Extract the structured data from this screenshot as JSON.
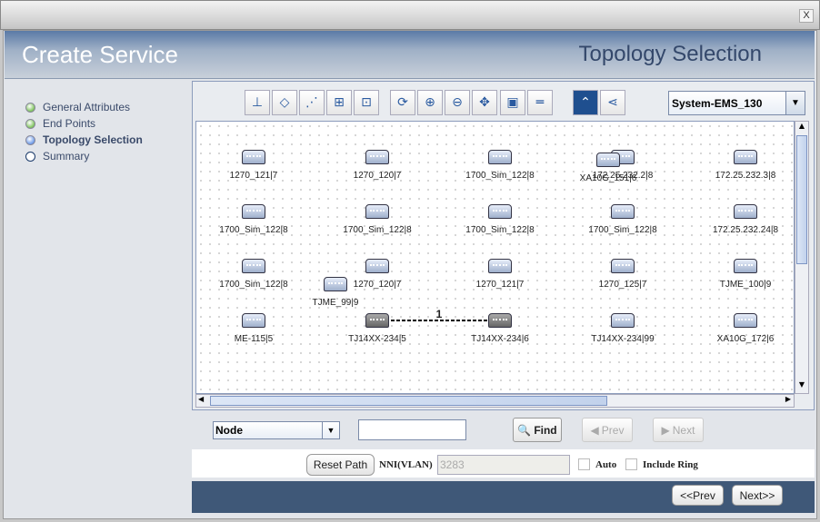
{
  "window": {
    "close_label": "X"
  },
  "header": {
    "title": "Create Service",
    "step_title": "Topology Selection"
  },
  "steps": [
    {
      "label": "General Attributes",
      "state": "done",
      "color": "#7cc25a"
    },
    {
      "label": "End Points",
      "state": "done",
      "color": "#7cc25a"
    },
    {
      "label": "Topology Selection",
      "state": "current",
      "color": "#6c9ae8"
    },
    {
      "label": "Summary",
      "state": "pending",
      "color": "#ffffff"
    }
  ],
  "toolbar": {
    "buttons": [
      "tree-layout-icon",
      "circular-layout-icon",
      "diagonal-layout-icon",
      "hierarchical-layout-icon",
      "grid-layout-icon",
      "refresh-icon",
      "zoom-in-icon",
      "zoom-out-icon",
      "pan-icon",
      "fit-icon",
      "line-icon",
      "collapse-icon",
      "share-icon"
    ],
    "ems_select": "System-EMS_130"
  },
  "topology": {
    "nodes": [
      {
        "label": "1270_121|7"
      },
      {
        "label": "1270_120|7"
      },
      {
        "label": "1700_Sim_122|8"
      },
      {
        "label": "172.25.232.2|8"
      },
      {
        "label": "172.25.232.3|8"
      },
      {
        "label": "1700_Sim_122|8"
      },
      {
        "label": "1700_Sim_122|8"
      },
      {
        "label": "1700_Sim_122|8"
      },
      {
        "label": "1700_Sim_122|8"
      },
      {
        "label": "172.25.232.24|8"
      },
      {
        "label": "1700_Sim_122|8"
      },
      {
        "label": "1270_120|7"
      },
      {
        "label": "1270_121|7"
      },
      {
        "label": "1270_125|7"
      },
      {
        "label": "TJME_100|9"
      },
      {
        "label": "ME-115|5"
      },
      {
        "label": "TJ14XX-234|5",
        "selected": true
      },
      {
        "label": "TJ14XX-234|6",
        "selected": true
      },
      {
        "label": "TJ14XX-234|99"
      },
      {
        "label": "XA10G_172|6"
      },
      {
        "label": "XA10G_151|6"
      },
      {
        "label": "TJME_99|9"
      }
    ],
    "link": {
      "label": "1",
      "from": "TJ14XX-234|5",
      "to": "TJ14XX-234|6"
    }
  },
  "search": {
    "type_select": "Node",
    "query": "",
    "find_label": "Find",
    "prev_label": "Prev",
    "next_label": "Next"
  },
  "path": {
    "reset_label": "Reset Path",
    "nni_label": "NNI(VLAN)",
    "nni_value": "3283",
    "auto_label": "Auto",
    "auto_checked": false,
    "ring_label": "Include Ring",
    "ring_checked": false
  },
  "nav": {
    "prev_label": "<<Prev",
    "next_label": "Next>>"
  }
}
